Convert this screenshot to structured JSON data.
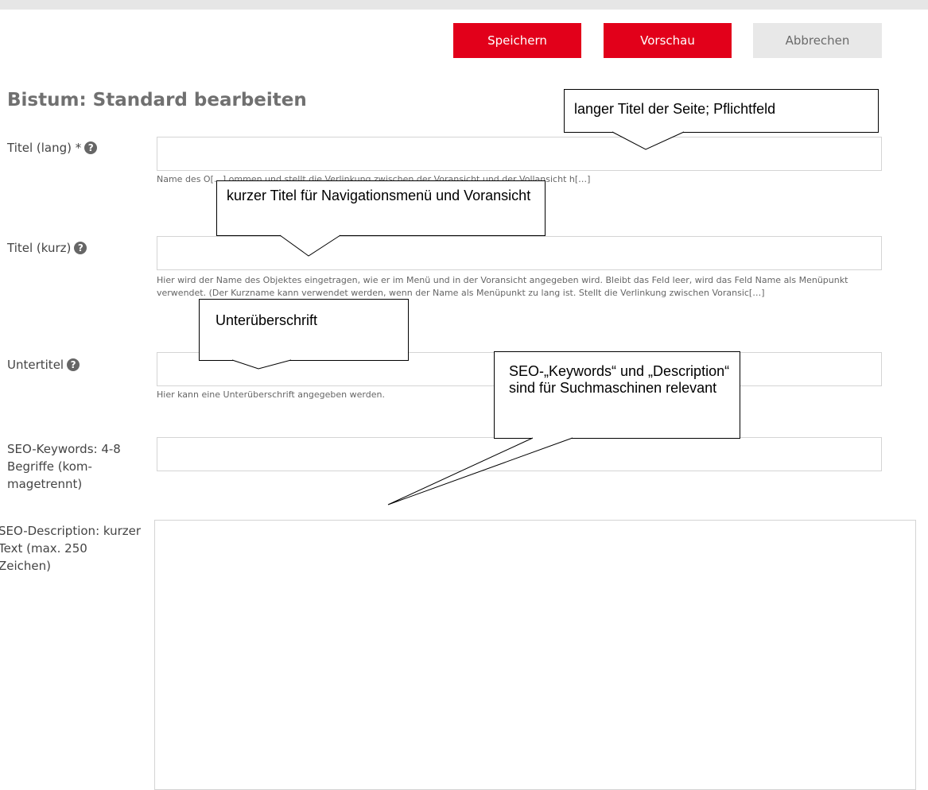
{
  "toolbar": {
    "save_label": "Speichern",
    "preview_label": "Vorschau",
    "cancel_label": "Abbrechen"
  },
  "page": {
    "title": "Bistum: Standard bearbeiten"
  },
  "colors": {
    "accent": "#e2001a",
    "cancel_bg": "#e8e8e8"
  },
  "help_icon": "question-circle-icon",
  "fields": {
    "title_long": {
      "label": "Titel (lang) *",
      "value": "",
      "hint": "Name des O[…] ommen und stellt die Verlinkung zwischen der Voransicht und der Vollansicht h[…]"
    },
    "title_short": {
      "label": "Titel (kurz)",
      "value": "",
      "hint": "Hier wird der Name des Objektes eingetragen, wie er im Menü und in der Voransicht angegeben wird. Bleibt das Feld leer, wird das Feld Name als Menüpunkt verwendet. (Der Kurzname kann verwendet werden, wenn der Name als Menüpunkt zu lang ist. Stellt die Verlinkung zwischen Voransic[…]"
    },
    "subtitle": {
      "label": "Untertitel",
      "value": "",
      "hint": "Hier kann eine Unterüberschrift angegeben werden."
    },
    "seo_keywords": {
      "label": "SEO-Keywords: 4-8 Begriffe (kom-magetrennt)",
      "value": ""
    },
    "seo_description": {
      "label": "SEO-Description: kurzer Text (max. 250 Zeichen)",
      "value": ""
    }
  },
  "callouts": {
    "title_long": "langer Titel der Seite; Pflichtfeld",
    "title_short": "kurzer Titel für Navigationsmenü und Voransicht",
    "subtitle": "Unterüberschrift",
    "seo": "SEO-„Keywords“ und „Description“ sind für Suchmaschinen relevant"
  }
}
